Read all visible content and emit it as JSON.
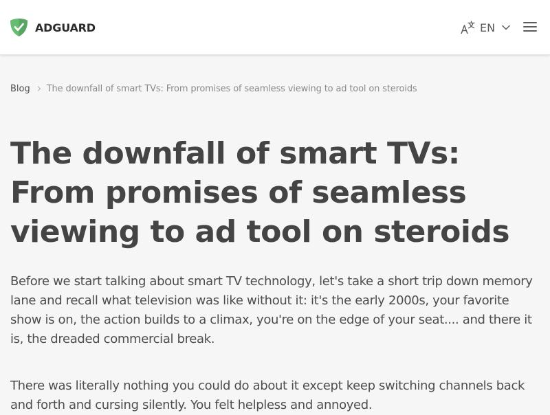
{
  "header": {
    "brand": "ADGUARD",
    "language": "EN",
    "colors": {
      "brand_green": "#68bc71",
      "brand_green_dark": "#58a564",
      "text_dark": "#2b2b2b"
    },
    "icons": {
      "logo": "shield-check-icon",
      "language": "translate-icon",
      "chevron": "chevron-down-icon",
      "menu": "hamburger-menu-icon"
    }
  },
  "breadcrumb": {
    "root": "Blog",
    "current": "The downfall of smart TVs: From promises of seamless viewing to ad tool on steroids"
  },
  "article": {
    "title": "The downfall of smart TVs: From promises of seamless viewing to ad tool on steroids",
    "paragraphs": [
      "Before we start talking about smart TV technology, let's take a short trip down memory lane and recall what television was like without it: it's the early 2000s, your favorite show is on, the action builds to a climax, you're on the edge of your seat.... and there it is, the dreaded commercial break.",
      "There was literally nothing you could do about it except keep switching channels back and forth and cursing silently. You felt helpless and annoyed."
    ]
  }
}
